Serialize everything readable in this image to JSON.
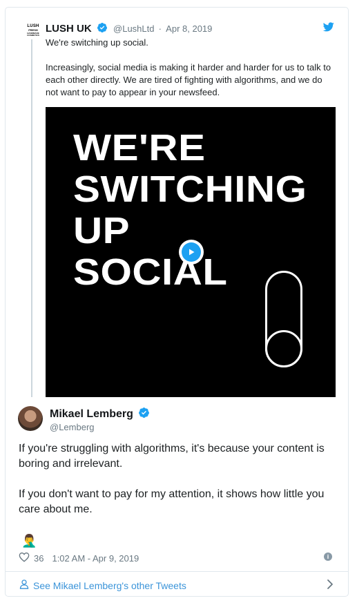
{
  "quoted_tweet": {
    "avatar_text": [
      "LUSH",
      "FRESH",
      "HANDMADE COSMETICS"
    ],
    "author_name": "LUSH UK",
    "author_handle": "@LushLtd",
    "date": "Apr 8, 2019",
    "text": "We're switching up social.\n\nIncreasingly, social media is making it harder and harder for us to talk to each other directly. We are tired of fighting with algorithms, and we do not want to pay to appear in your newsfeed.",
    "media_lines": [
      "WE'RE",
      "SWITCHING",
      "UP",
      "SOCIAL"
    ]
  },
  "tweet": {
    "author_name": "Mikael Lemberg",
    "author_handle": "@Lemberg",
    "text": "If you're struggling with algorithms, it's because your content is boring and irrelevant.\n\nIf you don't want to pay for my attention, it shows how little you care about me.",
    "emoji": "🤦‍♂️",
    "like_count": "36",
    "timestamp": "1:02 AM - Apr 9, 2019"
  },
  "footer": {
    "link_text": "See Mikael Lemberg's other Tweets"
  },
  "colors": {
    "twitter_blue": "#1da1f2",
    "link_blue": "#3b94d9",
    "muted": "#697882"
  },
  "icons": [
    "verified-badge-icon",
    "twitter-bird-icon",
    "play-icon",
    "heart-icon",
    "info-icon",
    "person-icon",
    "chevron-right-icon"
  ]
}
